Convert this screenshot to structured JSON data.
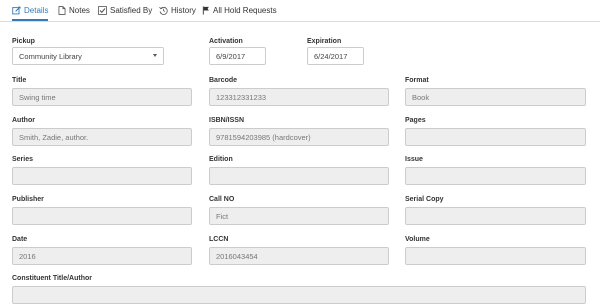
{
  "tabs": [
    {
      "label": "Details",
      "icon": "edit-icon",
      "active": true
    },
    {
      "label": "Notes",
      "icon": "document-icon",
      "active": false
    },
    {
      "label": "Satisfied By",
      "icon": "checkbox-icon",
      "active": false
    },
    {
      "label": "History",
      "icon": "history-icon",
      "active": false
    },
    {
      "label": "All Hold Requests",
      "icon": "flag-icon",
      "active": false
    }
  ],
  "form": {
    "pickup": {
      "label": "Pickup",
      "value": "Community Library"
    },
    "activation": {
      "label": "Activation",
      "value": "6/9/2017"
    },
    "expiration": {
      "label": "Expiration",
      "value": "6/24/2017"
    },
    "title": {
      "label": "Title",
      "value": "Swing time"
    },
    "barcode": {
      "label": "Barcode",
      "value": "123312331233"
    },
    "format": {
      "label": "Format",
      "value": "Book"
    },
    "author": {
      "label": "Author",
      "value": "Smith, Zadie, author."
    },
    "isbn": {
      "label": "ISBN/ISSN",
      "value": "9781594203985 (hardcover)"
    },
    "pages": {
      "label": "Pages",
      "value": ""
    },
    "series": {
      "label": "Series",
      "value": ""
    },
    "edition": {
      "label": "Edition",
      "value": ""
    },
    "issue": {
      "label": "Issue",
      "value": ""
    },
    "publisher": {
      "label": "Publisher",
      "value": ""
    },
    "call_no": {
      "label": "Call NO",
      "value": "Fict"
    },
    "serial_copy": {
      "label": "Serial Copy",
      "value": ""
    },
    "date": {
      "label": "Date",
      "value": "2016"
    },
    "lccn": {
      "label": "LCCN",
      "value": "2016043454"
    },
    "volume": {
      "label": "Volume",
      "value": ""
    },
    "constituent": {
      "label": "Constituent Title/Author",
      "value": ""
    }
  },
  "colors": {
    "accent": "#337ab7",
    "readonly_bg": "#eeeeee",
    "border": "#cccccc"
  }
}
